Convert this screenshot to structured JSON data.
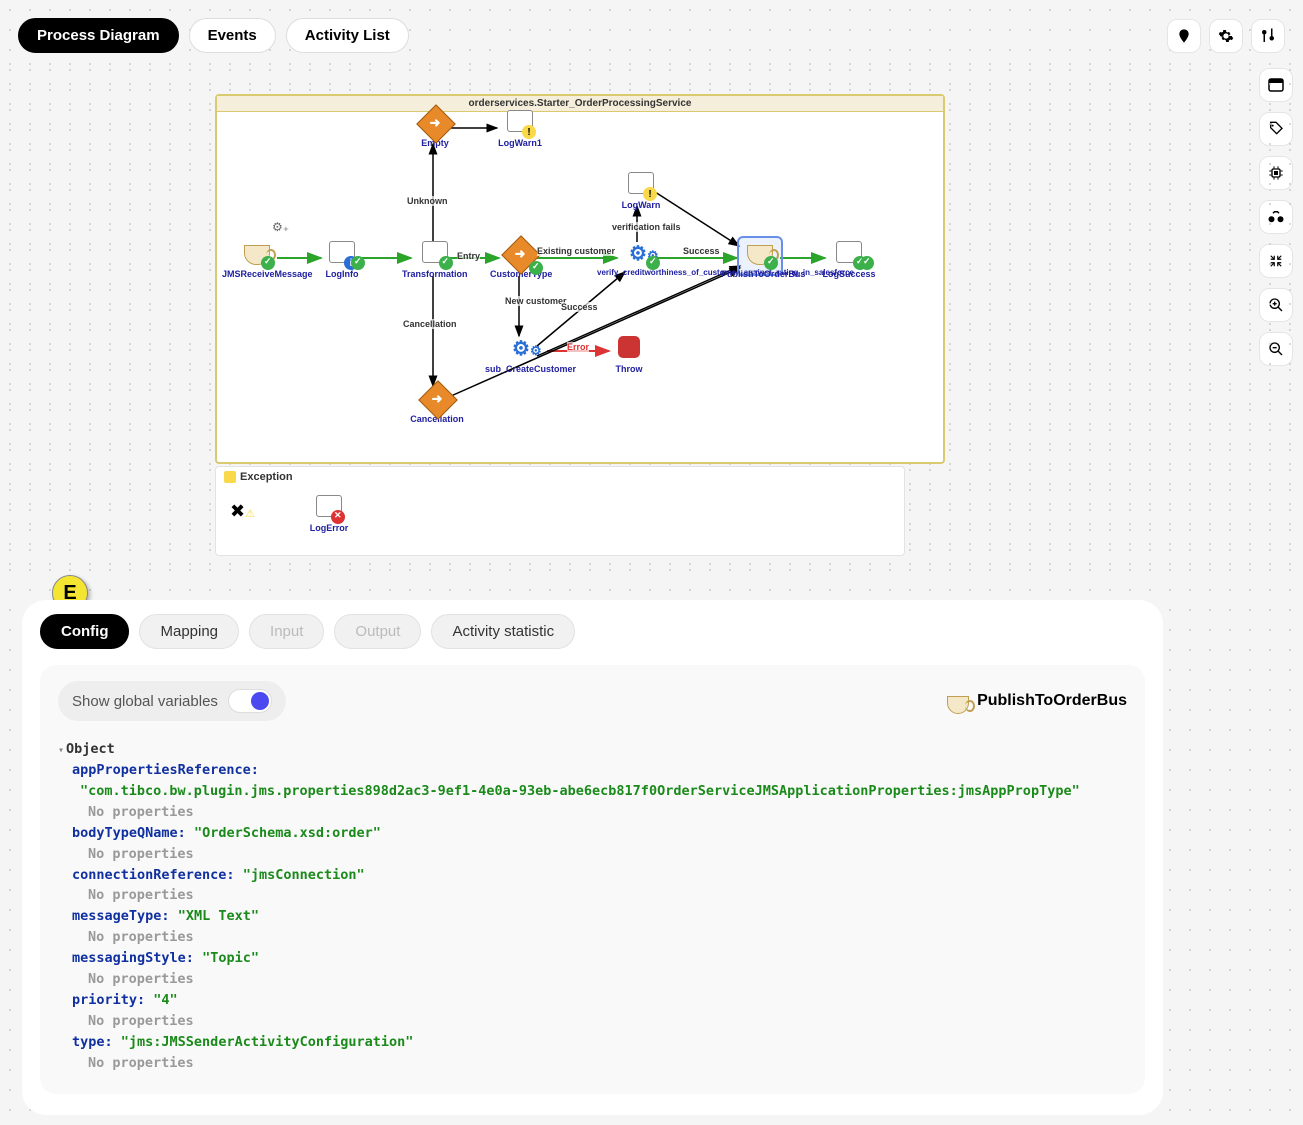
{
  "top_tabs": {
    "process_diagram": "Process Diagram",
    "events": "Events",
    "activity_list": "Activity List"
  },
  "diagram": {
    "title": "orderservices.Starter_OrderProcessingService",
    "nodes": {
      "jmsreceive": "JMSReceiveMessage",
      "loginfo": "LogInfo",
      "transformation": "Transformation",
      "empty": "Empty",
      "logwarn1": "LogWarn1",
      "customertype": "CustomerType",
      "logwarn": "LogWarn",
      "verify": "verify_creditworthiness_of_customer_against_rating_in_salesforce",
      "publish": "PublishToOrderBus",
      "logsuccess": "LogSuccess",
      "subcreate": "sub_CreateCustomer",
      "throw": "Throw",
      "cancellation": "Cancellation"
    },
    "edge_labels": {
      "unknown": "Unknown",
      "entry": "Entry",
      "existing": "Existing customer",
      "verfails": "verification fails",
      "success1": "Success",
      "newcust": "New customer",
      "success2": "Success",
      "error": "Error",
      "cancel": "Cancellation"
    },
    "exception": {
      "title": "Exception",
      "logerror": "LogError"
    }
  },
  "marker_e": "E",
  "bottom_tabs": {
    "config": "Config",
    "mapping": "Mapping",
    "input": "Input",
    "output": "Output",
    "stats": "Activity statistic"
  },
  "toggle_label": "Show global variables",
  "activity_name": "PublishToOrderBus",
  "config_tree": {
    "root": "Object",
    "no_props": "No properties",
    "entries": [
      {
        "key": "appPropertiesReference:",
        "val": "\"com.tibco.bw.plugin.jms.properties898d2ac3-9ef1-4e0a-93eb-abe6ecb817f0OrderServiceJMSApplicationProperties:jmsAppPropType\"",
        "wrap": true
      },
      {
        "key": "bodyTypeQName:",
        "val": "\"OrderSchema.xsd:order\""
      },
      {
        "key": "connectionReference:",
        "val": "\"jmsConnection\""
      },
      {
        "key": "messageType:",
        "val": "\"XML Text\""
      },
      {
        "key": "messagingStyle:",
        "val": "\"Topic\""
      },
      {
        "key": "priority:",
        "val": "\"4\""
      },
      {
        "key": "type:",
        "val": "\"jms:JMSSenderActivityConfiguration\""
      }
    ]
  }
}
